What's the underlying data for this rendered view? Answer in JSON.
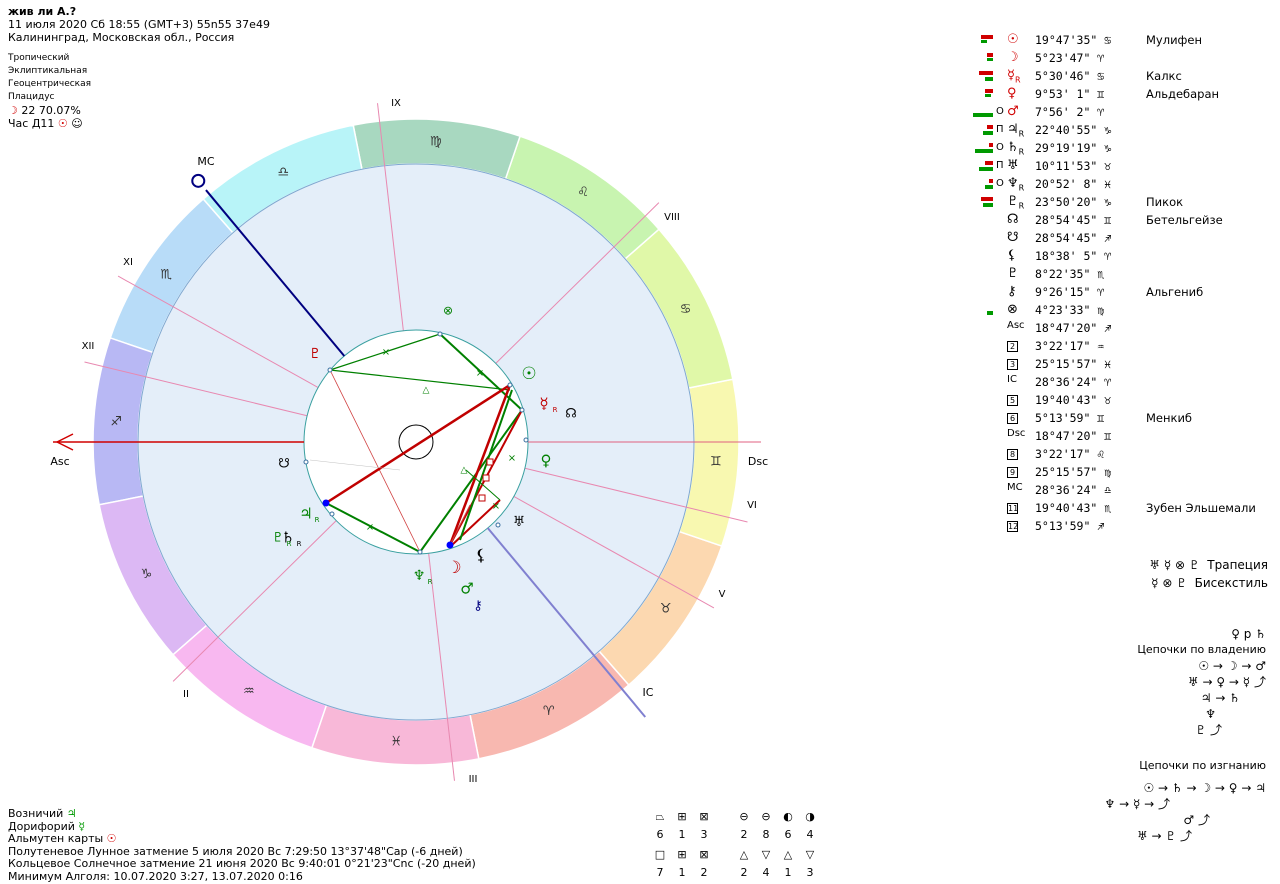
{
  "header": {
    "title": "жив ли А.?",
    "datetime": "11 июля 2020  Сб  18:55 (GMT+3) 55n55  37e49",
    "place": "Калининград, Московская обл., Россия",
    "zodiac": "Тропический",
    "coords": "Эклиптикальная",
    "center": "Геоцентрическая",
    "houses": "Плацидус",
    "moon_phase": "22 70.07%",
    "hour_label": "Час Д11"
  },
  "planets": [
    {
      "glyph": "☉",
      "red": true,
      "pos": "19°47'35\"",
      "sign": "♋",
      "star": "Мулифен",
      "mark": ""
    },
    {
      "glyph": "☽",
      "red": true,
      "pos": " 5°23'47\"",
      "sign": "♈",
      "star": "",
      "mark": ""
    },
    {
      "glyph": "☿R",
      "red": true,
      "pos": " 5°30'46\"",
      "sign": "♋",
      "star": "Калкс",
      "mark": ""
    },
    {
      "glyph": "♀",
      "red": true,
      "pos": " 9°53' 1\"",
      "sign": "♊",
      "star": "Альдебаран",
      "mark": ""
    },
    {
      "glyph": "♂",
      "red": true,
      "pos": " 7°56' 2\"",
      "sign": "♈",
      "star": "",
      "mark": "О"
    },
    {
      "glyph": "♃R",
      "red": false,
      "pos": "22°40'55\"",
      "sign": "♑",
      "star": "",
      "mark": "П"
    },
    {
      "glyph": "♄R",
      "red": false,
      "pos": "29°19'19\"",
      "sign": "♑",
      "star": "",
      "mark": "О"
    },
    {
      "glyph": "♅",
      "red": false,
      "pos": "10°11'53\"",
      "sign": "♉",
      "star": "",
      "mark": "П"
    },
    {
      "glyph": "♆R",
      "red": false,
      "pos": "20°52' 8\"",
      "sign": "♓",
      "star": "",
      "mark": "О"
    },
    {
      "glyph": "♇R",
      "red": false,
      "pos": "23°50'20\"",
      "sign": "♑",
      "star": "Пикок",
      "mark": ""
    },
    {
      "glyph": "☊",
      "red": false,
      "pos": "28°54'45\"",
      "sign": "♊",
      "star": "Бетельгейзе",
      "mark": ""
    },
    {
      "glyph": "☋",
      "red": false,
      "pos": "28°54'45\"",
      "sign": "♐",
      "star": "",
      "mark": ""
    },
    {
      "glyph": "⚸",
      "red": false,
      "pos": "18°38' 5\"",
      "sign": "♈",
      "star": "",
      "mark": ""
    },
    {
      "glyph": "♇",
      "red": false,
      "pos": " 8°22'35\"",
      "sign": "♏",
      "star": "",
      "mark": ""
    },
    {
      "glyph": "⚷",
      "red": false,
      "pos": " 9°26'15\"",
      "sign": "♈",
      "star": "Альгениб",
      "mark": ""
    },
    {
      "glyph": "⊗",
      "red": false,
      "pos": " 4°23'33\"",
      "sign": "♍",
      "star": "",
      "mark": ""
    },
    {
      "glyph": "Asc",
      "red": false,
      "pos": "18°47'20\"",
      "sign": "♐",
      "star": "",
      "mark": ""
    },
    {
      "glyph": "2",
      "red": false,
      "pos": " 3°22'17\"",
      "sign": "♒",
      "star": "",
      "mark": ""
    },
    {
      "glyph": "3",
      "red": false,
      "pos": "25°15'57\"",
      "sign": "♓",
      "star": "",
      "mark": ""
    },
    {
      "glyph": "IC",
      "red": false,
      "pos": "28°36'24\"",
      "sign": "♈",
      "star": "",
      "mark": ""
    },
    {
      "glyph": "5",
      "red": false,
      "pos": "19°40'43\"",
      "sign": "♉",
      "star": "",
      "mark": ""
    },
    {
      "glyph": "6",
      "red": false,
      "pos": " 5°13'59\"",
      "sign": "♊",
      "star": "Менкиб",
      "mark": ""
    },
    {
      "glyph": "Dsc",
      "red": false,
      "pos": "18°47'20\"",
      "sign": "♊",
      "star": "",
      "mark": ""
    },
    {
      "glyph": "8",
      "red": false,
      "pos": " 3°22'17\"",
      "sign": "♌",
      "star": "",
      "mark": ""
    },
    {
      "glyph": "9",
      "red": false,
      "pos": "25°15'57\"",
      "sign": "♍",
      "star": "",
      "mark": ""
    },
    {
      "glyph": "MC",
      "red": false,
      "pos": "28°36'24\"",
      "sign": "♎",
      "star": "",
      "mark": ""
    },
    {
      "glyph": "11",
      "red": false,
      "pos": "19°40'43\"",
      "sign": "♏",
      "star": "Зубен Эльшемали",
      "mark": ""
    },
    {
      "glyph": "12",
      "red": false,
      "pos": " 5°13'59\"",
      "sign": "♐",
      "star": "",
      "mark": ""
    }
  ],
  "configs": {
    "trapeze_glyphs": "♅ ☿ ⊗ ♇",
    "trapeze_label": "Трапеция",
    "bisextile_glyphs": "☿ ⊗ ♇",
    "bisextile_label": "Бисекстиль"
  },
  "chains": {
    "top_line": "♀ р ♄",
    "rule_title": "Цепочки по владению",
    "rule_lines": [
      "☉ → ☽ → ♂",
      "♅ → ♀ → ☿ ⤴",
      "♃ → ♄",
      "♆",
      "♇ ⤴"
    ],
    "exile_title": "Цепочки по изгнанию",
    "exile_lines": [
      "☉ → ♄ → ☽ → ♀ → ♃",
      "♆ → ☿ → ⤴",
      "♂ ⤴",
      "♅ → ♇ ⤴"
    ]
  },
  "footer": {
    "voznich": "Возничий",
    "voznich_glyph": "♃",
    "dorif": "Дорифорий",
    "dorif_glyph": "☿",
    "almuten": "Альмутен карты",
    "almuten_glyph": "☉",
    "eclipse1": "Полутеневое Лунное затмение 5 июля 2020 Вс  7:29:50 13°37'48\"Cap (-6 дней)",
    "eclipse2": "Кольцевое Солнечное затмение 21 июня 2020 Вс  9:40:01  0°21'23\"Cnc (-20 дней)",
    "algol": "Минимум Алголя: 10.07.2020  3:27,  13.07.2020  0:16"
  },
  "aspect_counts": {
    "row1_symbols": [
      "⏢",
      "⊞",
      "⊠",
      "⊖",
      "⊖",
      "◐",
      "◑"
    ],
    "row1_values": [
      "6",
      "1",
      "3",
      "2",
      "8",
      "6",
      "4"
    ],
    "row2_symbols": [
      "□",
      "⊞",
      "⊠",
      "△",
      "▽",
      "△",
      "▽"
    ],
    "row2_values": [
      "7",
      "1",
      "2",
      "2",
      "4",
      "1",
      "3"
    ]
  },
  "wheel": {
    "asc_label": "Asc",
    "dsc_label": "Dsc",
    "mc_label": "MC",
    "ic_label": "IC",
    "house_labels": [
      "XII",
      "XI",
      "IX",
      "VIII",
      "VI",
      "V",
      "III",
      "II"
    ],
    "sign_glyphs": [
      "♐",
      "♏",
      "♎",
      "♍",
      "♌",
      "♋",
      "♊",
      "♉",
      "♈",
      "♓",
      "♒",
      "♑"
    ],
    "sign_colors": [
      "#b8b8f4",
      "#b8dcf8",
      "#b8f4f8",
      "#a8d8c0",
      "#c8f4b0",
      "#e0f8a8",
      "#f8f8b0",
      "#fcd8b0",
      "#f8b8b0",
      "#f8b8d8",
      "#f8b8f0",
      "#dcb8f4"
    ],
    "chart_glyphs": {
      "sun": "☉",
      "mercury": "☿",
      "node": "☊",
      "venus": "♀",
      "uranus": "♅",
      "lilith": "⚸",
      "moon": "☽",
      "mars": "♂",
      "chiron": "⚷",
      "neptune": "♆",
      "jupiter": "♃",
      "saturn": "♄",
      "pluto": "♇",
      "fortune": "⊗",
      "south_node": "☋",
      "proserpina": "♇"
    }
  }
}
